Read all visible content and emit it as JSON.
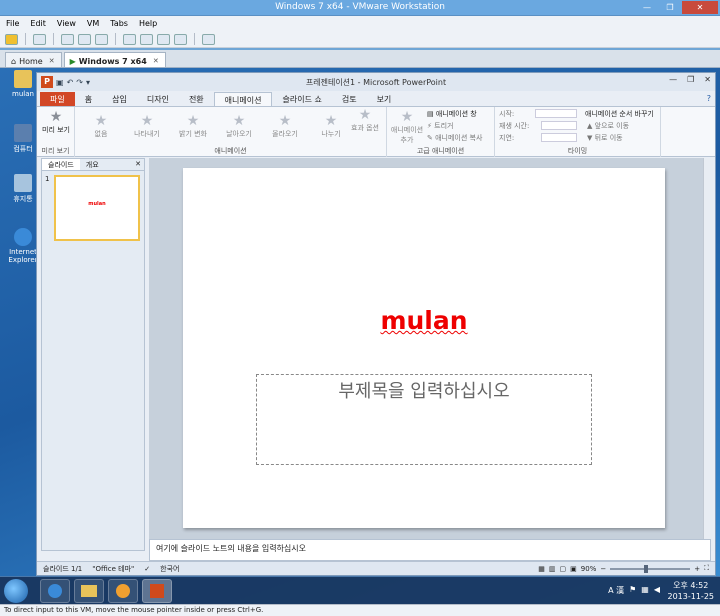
{
  "vmware": {
    "title": "Windows 7 x64 - VMware Workstation",
    "menu": [
      "File",
      "Edit",
      "View",
      "VM",
      "Tabs",
      "Help"
    ],
    "tabs": [
      {
        "label": "Home"
      },
      {
        "label": "Windows 7 x64"
      }
    ],
    "status_hint": "To direct input to this VM, move the mouse pointer inside or press Ctrl+G."
  },
  "desktop": {
    "icons": [
      {
        "label": "mulan"
      },
      {
        "label": "컴퓨터"
      },
      {
        "label": "휴지통"
      },
      {
        "label": "Internet Explorer"
      }
    ]
  },
  "powerpoint": {
    "window_title": "프레젠테이션1 - Microsoft PowerPoint",
    "ribbon_tabs": [
      "파일",
      "홈",
      "삽입",
      "디자인",
      "전환",
      "애니메이션",
      "슬라이드 쇼",
      "검토",
      "보기"
    ],
    "preview_group": {
      "button": "미리 보기",
      "label": "미리 보기"
    },
    "animation_group": {
      "label": "애니메이션",
      "effects": [
        "없음",
        "나타내기",
        "밝기 변화",
        "날아오기",
        "올라오기",
        "나누기"
      ],
      "effect_options": "효과 옵션"
    },
    "advanced_group": {
      "label": "고급 애니메이션",
      "add_animation": "애니메이션 추가",
      "pane": "애니메이션 창",
      "trigger": "트리거",
      "painter": "애니메이션 복사"
    },
    "timing_group": {
      "label": "타이밍",
      "start": "시작:",
      "duration": "재생 시간:",
      "delay": "지연:",
      "reorder": "애니메이션 순서 바꾸기",
      "move_earlier": "앞으로 이동",
      "move_later": "뒤로 이동"
    },
    "slide_panel": {
      "tabs": [
        "슬라이드",
        "개요"
      ],
      "thumb_number": "1",
      "thumb_title": "mulan"
    },
    "slide": {
      "title": "mulan",
      "subtitle_placeholder": "부제목을 입력하십시오"
    },
    "notes_placeholder": "여기에 슬라이드 노트의 내용을 입력하십시오",
    "status": {
      "slide_count": "슬라이드 1/1",
      "theme": "\"Office 테마\"",
      "language": "한국어",
      "zoom": "90%",
      "zoom_fraction": 0.45
    }
  },
  "taskbar": {
    "time": "오후 4:52",
    "date": "2013-11-25",
    "ime": "A 漢"
  }
}
